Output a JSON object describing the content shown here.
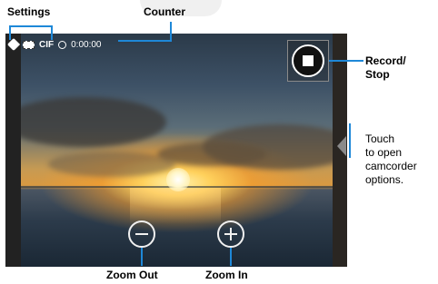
{
  "status_bar": {
    "resolution": "CIF",
    "timer": "0:00:00"
  },
  "icons": {
    "settings": "tag-icon",
    "video_quality": "film-icon",
    "recording_indicator": "circle-icon",
    "record": "stop-icon",
    "zoom_out": "minus-circle-icon",
    "zoom_in": "plus-circle-icon",
    "options_tab": "triangle-left-icon"
  },
  "callouts": {
    "settings": "Settings",
    "counter": "Counter",
    "record_stop": "Record/\nStop",
    "options": "Touch\nto open\ncamcorder\noptions.",
    "zoom_out": "Zoom Out",
    "zoom_in": "Zoom In"
  },
  "colors": {
    "callout_line": "#1e88d8"
  }
}
